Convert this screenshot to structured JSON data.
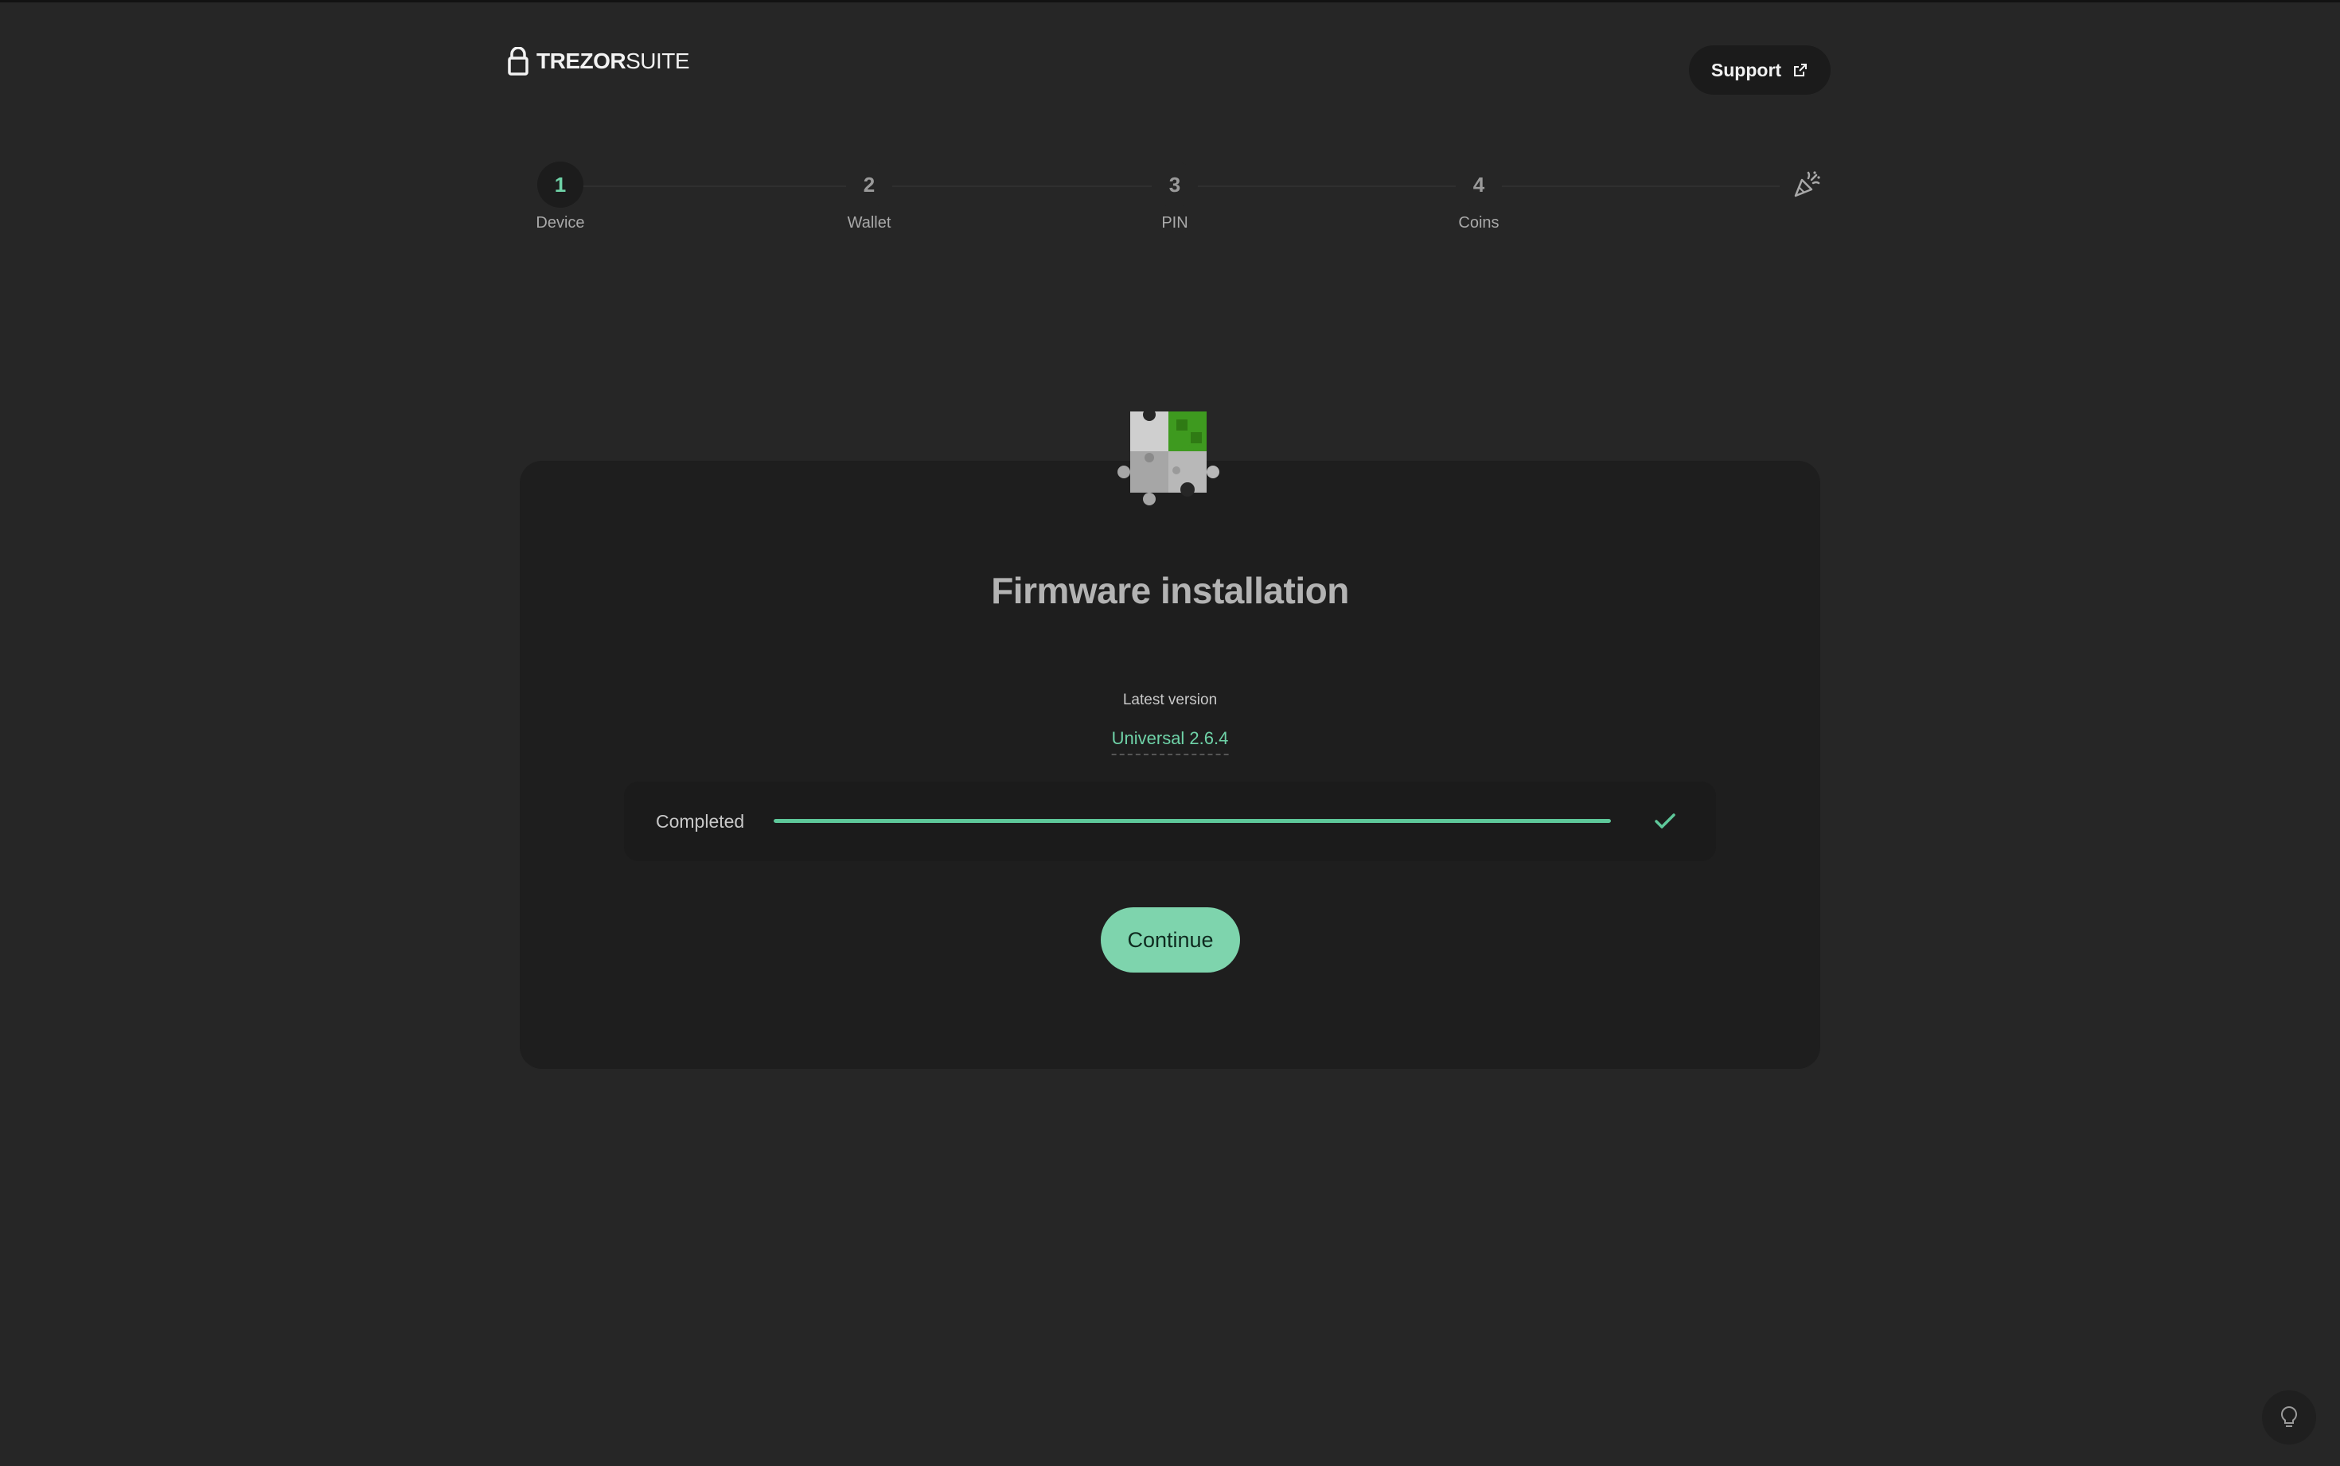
{
  "header": {
    "logo_bold": "TREZOR",
    "logo_light": "SUITE",
    "support_label": "Support"
  },
  "stepper": {
    "steps": [
      {
        "number": "1",
        "label": "Device",
        "active": true
      },
      {
        "number": "2",
        "label": "Wallet",
        "active": false
      },
      {
        "number": "3",
        "label": "PIN",
        "active": false
      },
      {
        "number": "4",
        "label": "Coins",
        "active": false
      }
    ],
    "final_icon": "party-popper-icon"
  },
  "card": {
    "illustration": "puzzle-icon",
    "title": "Firmware installation",
    "latest_label": "Latest version",
    "version": "Universal 2.6.4",
    "progress": {
      "label": "Completed",
      "percent": 100,
      "status_icon": "check-icon"
    },
    "continue_label": "Continue"
  },
  "footer": {
    "tip_icon": "lightbulb-icon"
  },
  "colors": {
    "background": "#262626",
    "card": "#1e1e1e",
    "accent": "#6fd3a8",
    "button": "#7ed4ad",
    "progress": "#5ec89a"
  }
}
